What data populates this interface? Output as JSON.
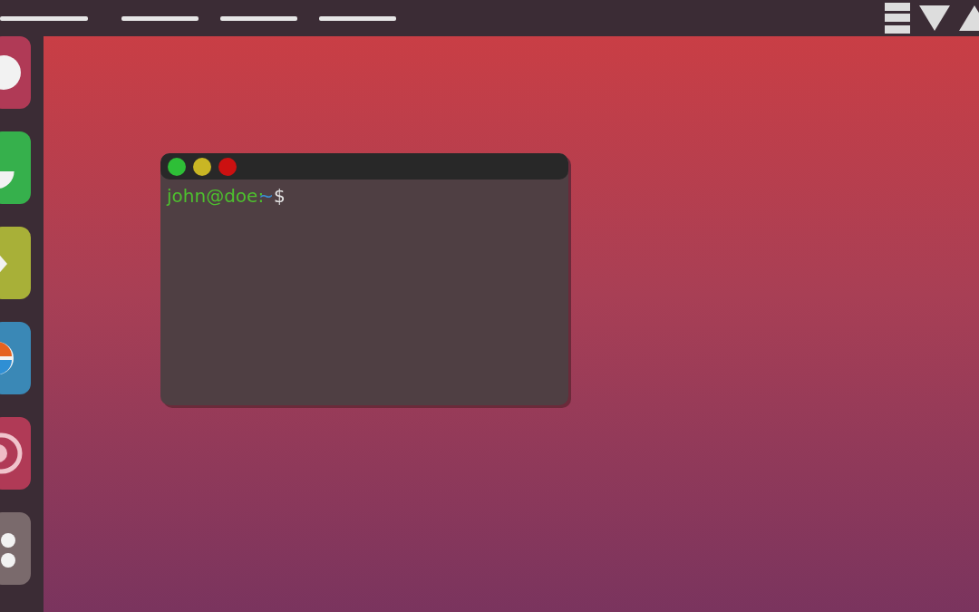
{
  "dock": {
    "items": [
      {
        "kind": "circle",
        "color": "#b03a56"
      },
      {
        "kind": "half",
        "color": "#36b04c"
      },
      {
        "kind": "chevron",
        "color": "#a8b038"
      },
      {
        "kind": "pie",
        "color": "#3a88b6"
      },
      {
        "kind": "rings",
        "color": "#b03a56"
      },
      {
        "kind": "dots",
        "color": "#7a6a6c"
      }
    ]
  },
  "terminal": {
    "controls": [
      {
        "color": "#2ebf37"
      },
      {
        "color": "#c9b624"
      },
      {
        "color": "#cc1111"
      }
    ],
    "prompt": {
      "user_host": "john@doe:",
      "path": "~",
      "symbol": "$"
    }
  }
}
